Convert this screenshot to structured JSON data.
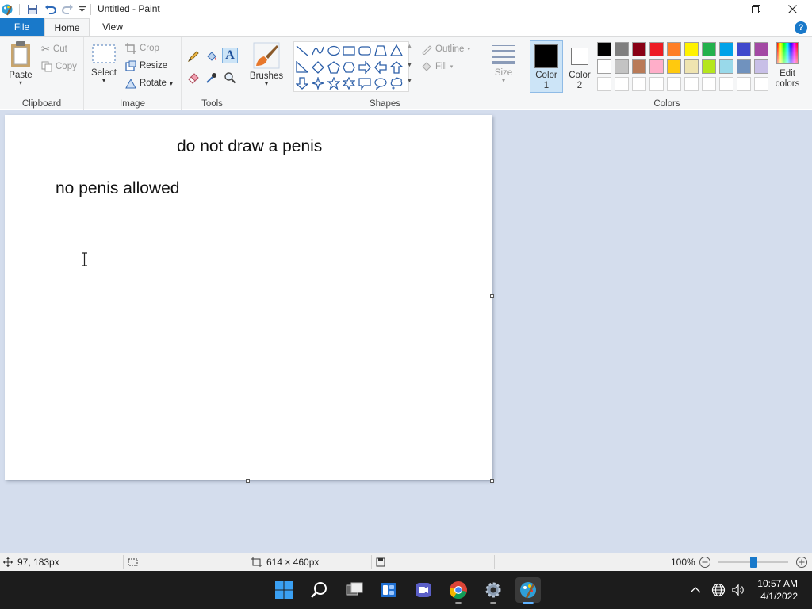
{
  "window": {
    "title": "Untitled - Paint"
  },
  "tabs": {
    "file": "File",
    "home": "Home",
    "view": "View",
    "help": "?"
  },
  "ribbon": {
    "clipboard": {
      "label": "Clipboard",
      "paste": "Paste",
      "cut": "Cut",
      "copy": "Copy"
    },
    "image": {
      "label": "Image",
      "select": "Select",
      "crop": "Crop",
      "resize": "Resize",
      "rotate": "Rotate"
    },
    "tools": {
      "label": "Tools"
    },
    "brushes": {
      "label": "Brushes"
    },
    "shapes": {
      "label": "Shapes",
      "outline": "Outline",
      "fill": "Fill"
    },
    "size": {
      "label": "Size"
    },
    "colors": {
      "label": "Colors",
      "color1": "Color 1",
      "color1_line1": "Color",
      "color1_line2": "1",
      "color2_line1": "Color",
      "color2_line2": "2",
      "edit_line1": "Edit",
      "edit_line2": "colors",
      "primary": "#000000",
      "secondary": "#ffffff",
      "palette_row1": [
        "#000000",
        "#7f7f7f",
        "#880015",
        "#ed1c24",
        "#ff7f27",
        "#fff200",
        "#22b14c",
        "#00a2e8",
        "#3f48cc",
        "#a349a4"
      ],
      "palette_row2": [
        "#ffffff",
        "#c3c3c3",
        "#b97a57",
        "#ffaec9",
        "#ffc90e",
        "#efe4b0",
        "#b5e61d",
        "#99d9ea",
        "#7092be",
        "#c8bfe7"
      ]
    }
  },
  "canvas": {
    "line1": "do not draw a penis",
    "line2": "no penis allowed"
  },
  "status": {
    "cursor_pos": "97, 183px",
    "canvas_size": "614 × 460px",
    "zoom": "100%",
    "zoom_level": 100
  },
  "taskbar": {
    "time": "10:57 AM",
    "date": "4/1/2022"
  }
}
